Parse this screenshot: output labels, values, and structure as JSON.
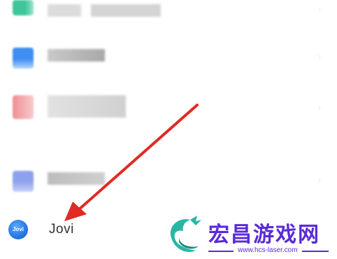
{
  "settings_list": {
    "items": [
      {
        "label": "",
        "icon": "settings-item-icon-green",
        "color": "#3ec59a"
      },
      {
        "label": "",
        "icon": "settings-item-icon-blue",
        "color": "#3f8ef2"
      },
      {
        "label": "",
        "icon": "settings-item-icon-red",
        "color": "#ef8f95"
      },
      {
        "label": "",
        "icon": "settings-item-icon-indigo",
        "color": "#8da2ef"
      }
    ],
    "jovi": {
      "label": "Jovi",
      "icon_text": "Jovi",
      "icon": "jovi-icon"
    }
  },
  "annotation": {
    "icon": "red-arrow",
    "color": "#e02a24"
  },
  "watermark": {
    "title": "宏昌游戏网",
    "url": "www.hcs-laser.com",
    "icon": "dragon-logo-icon",
    "colors": {
      "text": "#5a2bd6",
      "logo": "#2bb5a5"
    }
  }
}
